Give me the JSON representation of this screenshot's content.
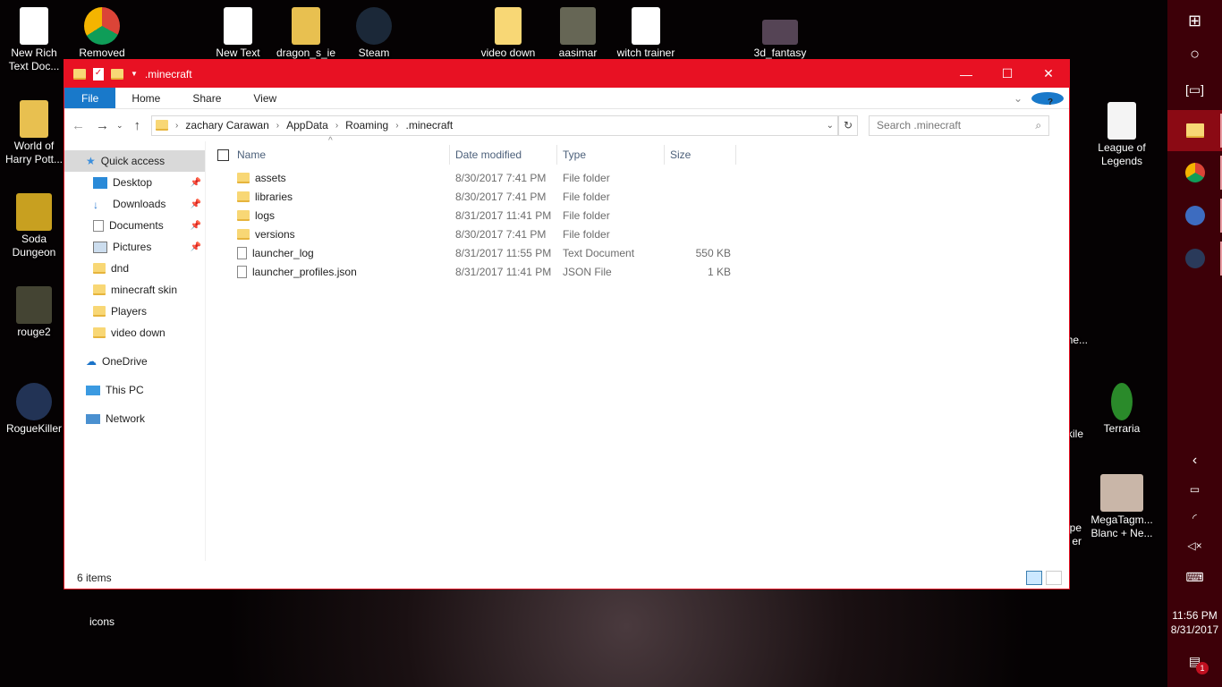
{
  "desktop": {
    "icons_left": [
      "New Rich Text Doc...",
      "World of Harry Pott...",
      "Soda Dungeon",
      "rouge2",
      "RogueKiller",
      "icons"
    ],
    "icons_top": [
      "Removed",
      "New Text",
      "dragon_s_ie",
      "Steam",
      "video down",
      "aasimar",
      "witch trainer",
      "3d_fantasy"
    ],
    "icons_right": [
      "League of Legends",
      "Terraria",
      "MegaTagm... Blanc + Ne..."
    ],
    "partial": [
      "me...",
      "kile",
      "pe",
      "er"
    ]
  },
  "window": {
    "title": ".minecraft",
    "controls": {
      "minimize": "—",
      "maximize": "☐",
      "close": "✕"
    }
  },
  "ribbon": {
    "tabs": [
      "File",
      "Home",
      "Share",
      "View"
    ]
  },
  "address": {
    "crumbs": [
      "zachary Carawan",
      "AppData",
      "Roaming",
      ".minecraft"
    ],
    "search_placeholder": "Search .minecraft"
  },
  "sidebar": {
    "quick_access": "Quick access",
    "items": [
      "Desktop",
      "Downloads",
      "Documents",
      "Pictures",
      "dnd",
      "minecraft skin",
      "Players",
      "video down"
    ],
    "onedrive": "OneDrive",
    "thispc": "This PC",
    "network": "Network"
  },
  "columns": [
    "Name",
    "Date modified",
    "Type",
    "Size"
  ],
  "files": [
    {
      "name": "assets",
      "date": "8/30/2017 7:41 PM",
      "type": "File folder",
      "size": "",
      "kind": "folder"
    },
    {
      "name": "libraries",
      "date": "8/30/2017 7:41 PM",
      "type": "File folder",
      "size": "",
      "kind": "folder"
    },
    {
      "name": "logs",
      "date": "8/31/2017 11:41 PM",
      "type": "File folder",
      "size": "",
      "kind": "folder"
    },
    {
      "name": "versions",
      "date": "8/30/2017 7:41 PM",
      "type": "File folder",
      "size": "",
      "kind": "folder"
    },
    {
      "name": "launcher_log",
      "date": "8/31/2017 11:55 PM",
      "type": "Text Document",
      "size": "550 KB",
      "kind": "doc"
    },
    {
      "name": "launcher_profiles.json",
      "date": "8/31/2017 11:41 PM",
      "type": "JSON File",
      "size": "1 KB",
      "kind": "doc"
    }
  ],
  "status": {
    "count": "6 items"
  },
  "taskbar": {
    "time": "11:56 PM",
    "date": "8/31/2017",
    "notifications": "1"
  },
  "colors": {
    "accent": "#e81123",
    "taskbar": "#3d0008"
  }
}
